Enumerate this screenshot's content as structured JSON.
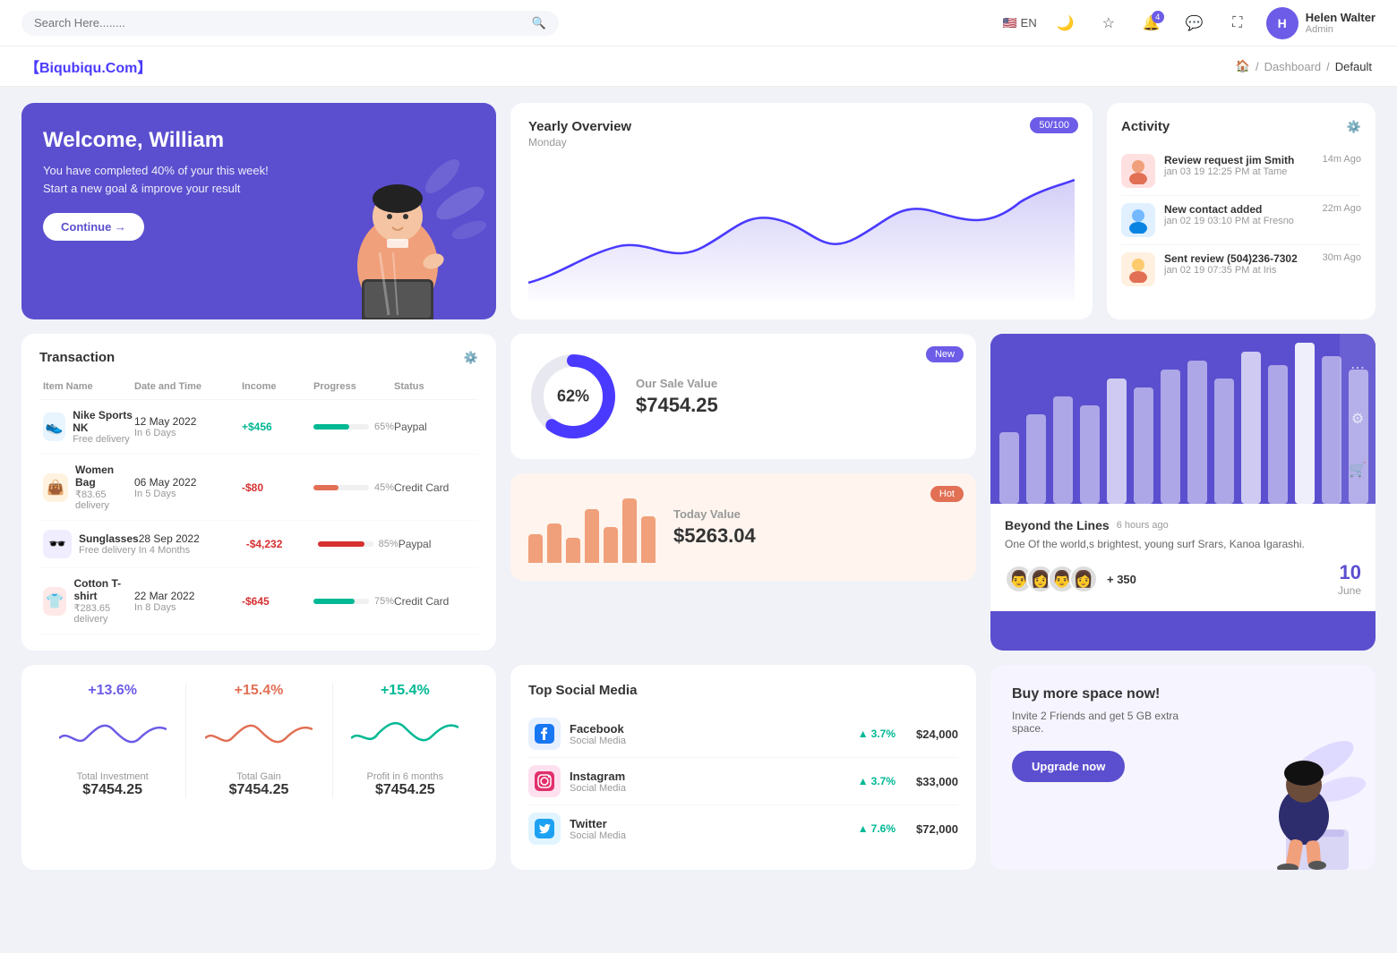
{
  "topnav": {
    "search_placeholder": "Search Here........",
    "lang": "EN",
    "notification_count": "4",
    "user": {
      "name": "Helen Walter",
      "role": "Admin"
    }
  },
  "breadcrumb": {
    "brand": "【Biqubiqu.Com】",
    "items": [
      "Home",
      "Dashboard",
      "Default"
    ]
  },
  "welcome": {
    "title": "Welcome, William",
    "subtitle": "You have completed 40% of your this week! Start a new goal & improve your result",
    "button": "Continue →"
  },
  "yearly_overview": {
    "title": "Yearly Overview",
    "day": "Monday",
    "badge": "50/100"
  },
  "activity": {
    "title": "Activity",
    "items": [
      {
        "title": "Review request jim Smith",
        "sub": "jan 03 19 12:25 PM at Tame",
        "time": "14m Ago"
      },
      {
        "title": "New contact added",
        "sub": "jan 02 19 03:10 PM at Fresno",
        "time": "22m Ago"
      },
      {
        "title": "Sent review (504)236-7302",
        "sub": "jan 02 19 07:35 PM at Iris",
        "time": "30m Ago"
      }
    ]
  },
  "transaction": {
    "title": "Transaction",
    "columns": [
      "Item Name",
      "Date and Time",
      "Income",
      "Progress",
      "Status"
    ],
    "rows": [
      {
        "name": "Nike Sports NK",
        "sub": "Free delivery",
        "date": "12 May 2022",
        "date_sub": "In 6 Days",
        "income": "+$456",
        "income_type": "pos",
        "progress": 65,
        "progress_color": "#00b894",
        "status": "Paypal",
        "icon": "👟",
        "icon_bg": "#e8f5ff"
      },
      {
        "name": "Women Bag",
        "sub": "₹83.65 delivery",
        "date": "06 May 2022",
        "date_sub": "In 5 Days",
        "income": "-$80",
        "income_type": "neg",
        "progress": 45,
        "progress_color": "#e17055",
        "status": "Credit Card",
        "icon": "👜",
        "icon_bg": "#fff3e0"
      },
      {
        "name": "Sunglasses",
        "sub": "Free delivery",
        "date": "28 Sep 2022",
        "date_sub": "In 4 Months",
        "income": "-$4,232",
        "income_type": "neg",
        "progress": 85,
        "progress_color": "#d63031",
        "status": "Paypal",
        "icon": "🕶️",
        "icon_bg": "#f0edff"
      },
      {
        "name": "Cotton T-shirt",
        "sub": "₹283.65 delivery",
        "date": "22 Mar 2022",
        "date_sub": "In 8 Days",
        "income": "-$645",
        "income_type": "neg",
        "progress": 75,
        "progress_color": "#00b894",
        "status": "Credit Card",
        "icon": "👕",
        "icon_bg": "#ffe8e8"
      }
    ]
  },
  "sale_value": {
    "badge": "New",
    "percent": "62%",
    "label": "Our Sale Value",
    "amount": "$7454.25",
    "donut_value": 62
  },
  "today_value": {
    "badge": "Hot",
    "label": "Today Value",
    "amount": "$5263.04",
    "bars": [
      40,
      55,
      35,
      70,
      45,
      80,
      60
    ]
  },
  "beyond": {
    "title": "Beyond the Lines",
    "time": "6 hours ago",
    "desc": "One Of the world,s brightest, young surf Srars, Kanoa Igarashi.",
    "plus_count": "+ 350",
    "date_num": "10",
    "date_mon": "June"
  },
  "stats": [
    {
      "pct": "+13.6%",
      "color": "#6c5ce7",
      "label": "Total Investment",
      "amount": "$7454.25"
    },
    {
      "pct": "+15.4%",
      "color": "#e17055",
      "label": "Total Gain",
      "amount": "$7454.25"
    },
    {
      "pct": "+15.4%",
      "color": "#00b894",
      "label": "Profit in 6 months",
      "amount": "$7454.25"
    }
  ],
  "social_media": {
    "title": "Top Social Media",
    "items": [
      {
        "name": "Facebook",
        "type": "Social Media",
        "change": "3.7%",
        "amount": "$24,000",
        "icon": "📘",
        "color": "#1877f2"
      },
      {
        "name": "Instagram",
        "type": "Social Media",
        "change": "3.7%",
        "amount": "$33,000",
        "icon": "📷",
        "color": "#e1306c"
      },
      {
        "name": "Twitter",
        "type": "Social Media",
        "change": "7.6%",
        "amount": "$72,000",
        "icon": "🐦",
        "color": "#1da1f2"
      }
    ]
  },
  "space": {
    "title": "Buy more space now!",
    "desc": "Invite 2 Friends and get 5 GB extra space.",
    "button": "Upgrade now"
  }
}
